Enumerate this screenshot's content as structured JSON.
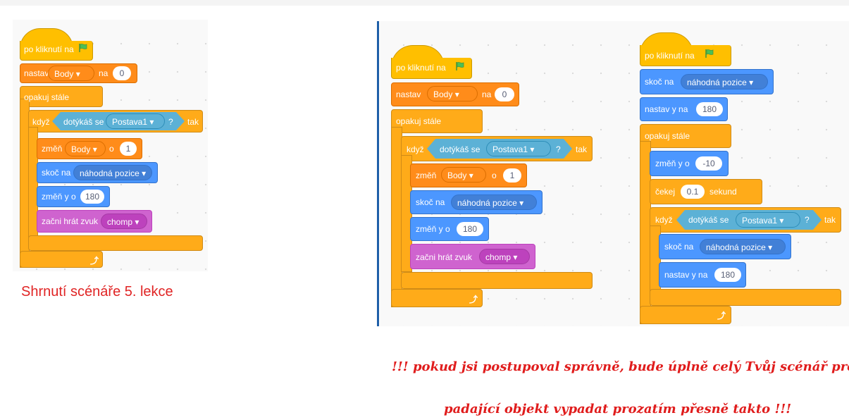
{
  "left_script": {
    "caption": "Shrnutí scénáře 5. lekce",
    "when_flag": "po kliknutí na",
    "set_var": {
      "label": "nastav",
      "var": "Body",
      "to": "na",
      "value": "0"
    },
    "forever": "opakuj stále",
    "if_block": {
      "label": "když",
      "sensing": "dotýkáš se",
      "target": "Postava1",
      "q": "?",
      "then": "tak"
    },
    "change_var": {
      "label": "změň",
      "var": "Body",
      "by": "o",
      "value": "1"
    },
    "goto": {
      "label": "skoč na",
      "target": "náhodná pozice"
    },
    "change_y": {
      "label": "změň y o",
      "value": "180"
    },
    "sound": {
      "label": "začni hrát zvuk",
      "sound": "chomp"
    }
  },
  "right_script_a": {
    "when_flag": "po kliknutí na",
    "set_var": {
      "label": "nastav",
      "var": "Body",
      "to": "na",
      "value": "0"
    },
    "forever": "opakuj stále",
    "if_block": {
      "label": "když",
      "sensing": "dotýkáš se",
      "target": "Postava1",
      "q": "?",
      "then": "tak"
    },
    "change_var": {
      "label": "změň",
      "var": "Body",
      "by": "o",
      "value": "1"
    },
    "goto": {
      "label": "skoč na",
      "target": "náhodná pozice"
    },
    "change_y": {
      "label": "změň y o",
      "value": "180"
    },
    "sound": {
      "label": "začni hrát zvuk",
      "sound": "chomp"
    }
  },
  "right_script_b": {
    "when_flag": "po kliknutí na",
    "goto": {
      "label": "skoč na",
      "target": "náhodná pozice"
    },
    "set_y": {
      "label": "nastav y na",
      "value": "180"
    },
    "forever": "opakuj stále",
    "change_y": {
      "label": "změň y o",
      "value": "-10"
    },
    "wait": {
      "label": "čekej",
      "value": "0.1",
      "unit": "sekund"
    },
    "if_block": {
      "label": "když",
      "sensing": "dotýkáš se",
      "target": "Postava1",
      "q": "?",
      "then": "tak"
    },
    "goto2": {
      "label": "skoč na",
      "target": "náhodná pozice"
    },
    "set_y2": {
      "label": "nastav y na",
      "value": "180"
    }
  },
  "note": {
    "line1": "!!! pokud jsi postupoval správně, bude úplně celý Tvůj scénář pro",
    "line2": "padající objekt vypadat prozatím přesně takto !!!"
  },
  "colors": {
    "events": "#ffbf00",
    "variables": "#ff8c1a",
    "control": "#ffab19",
    "motion": "#4c97ff",
    "sound": "#cf63cf",
    "sensing": "#5cb1d6",
    "note": "#e01c1c"
  },
  "icons": {
    "flag": "green-flag-icon",
    "dropdown": "triangle-down-icon",
    "loop": "loop-arrow-icon"
  }
}
